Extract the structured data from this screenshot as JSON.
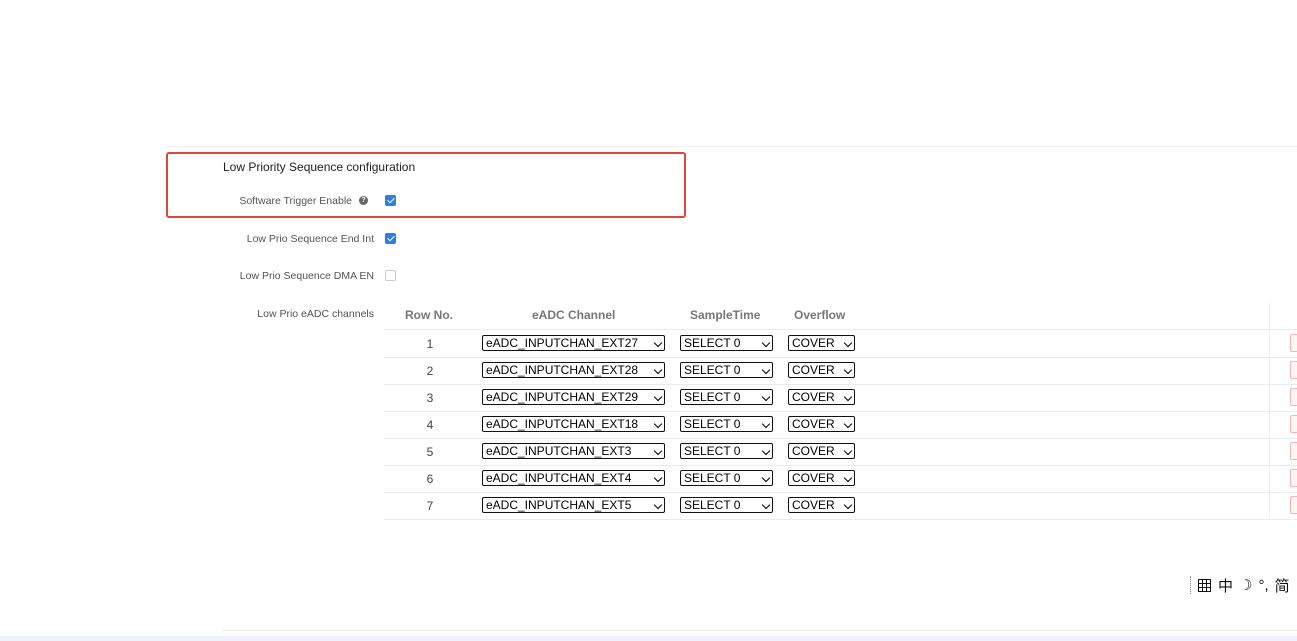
{
  "section": {
    "title": "Low Priority Sequence configuration"
  },
  "fields": {
    "software_trigger": {
      "label": "Software Trigger Enable",
      "checked": true,
      "help_icon": "question-circle-icon"
    },
    "end_int": {
      "label": "Low Prio Sequence End Int",
      "checked": true
    },
    "dma_en": {
      "label": "Low Prio Sequence DMA EN",
      "checked": false
    },
    "channels": {
      "label": "Low Prio eADC channels"
    }
  },
  "table": {
    "headers": {
      "row_no": "Row No.",
      "channel": "eADC Channel",
      "sample_time": "SampleTime",
      "overflow": "Overflow"
    },
    "rows": [
      {
        "no": "1",
        "channel": "eADC_INPUTCHAN_EXT27",
        "sample_time": "SELECT 0",
        "overflow": "COVER"
      },
      {
        "no": "2",
        "channel": "eADC_INPUTCHAN_EXT28",
        "sample_time": "SELECT 0",
        "overflow": "COVER"
      },
      {
        "no": "3",
        "channel": "eADC_INPUTCHAN_EXT29",
        "sample_time": "SELECT 0",
        "overflow": "COVER"
      },
      {
        "no": "4",
        "channel": "eADC_INPUTCHAN_EXT18",
        "sample_time": "SELECT 0",
        "overflow": "COVER"
      },
      {
        "no": "5",
        "channel": "eADC_INPUTCHAN_EXT3",
        "sample_time": "SELECT 0",
        "overflow": "COVER"
      },
      {
        "no": "6",
        "channel": "eADC_INPUTCHAN_EXT4",
        "sample_time": "SELECT 0",
        "overflow": "COVER"
      },
      {
        "no": "7",
        "channel": "eADC_INPUTCHAN_EXT5",
        "sample_time": "SELECT 0",
        "overflow": "COVER"
      }
    ]
  },
  "ime": {
    "mode": "中",
    "moon": "☽",
    "punct": "°,",
    "script": "简"
  },
  "colors": {
    "highlight": "#e0453a",
    "checkbox": "#2f7fe0"
  }
}
